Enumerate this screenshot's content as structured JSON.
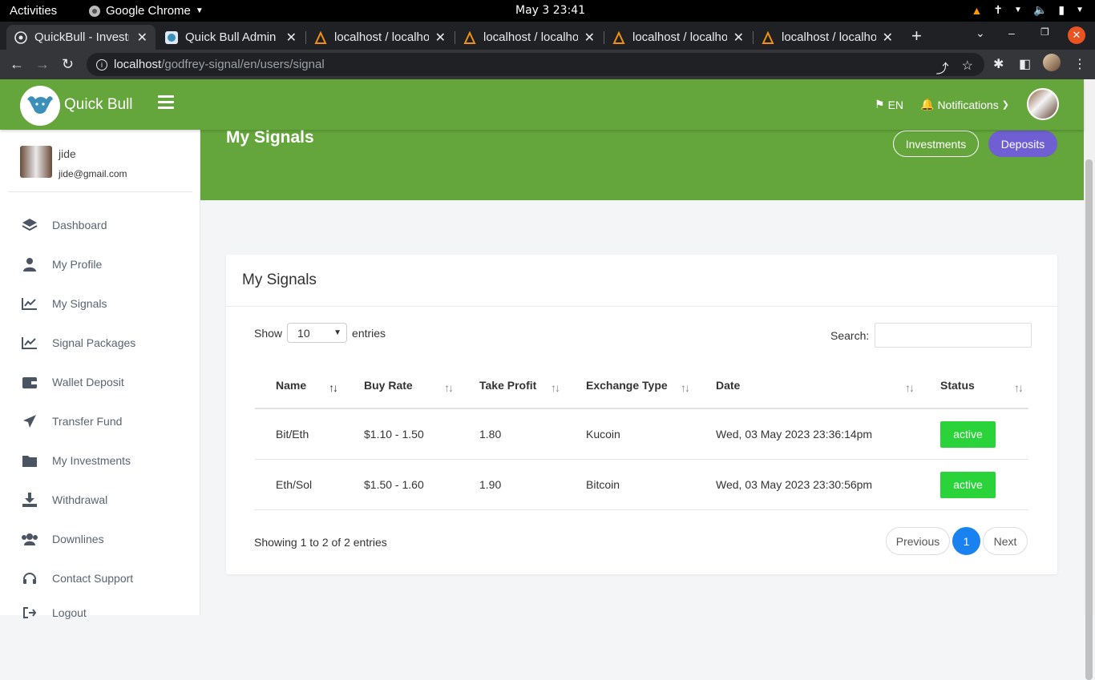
{
  "os": {
    "activities": "Activities",
    "app_name": "Google Chrome",
    "clock": "May 3  23:41"
  },
  "tabs": [
    {
      "title": "QuickBull - Investm"
    },
    {
      "title": "Quick Bull Admin"
    },
    {
      "title": "localhost / localho"
    },
    {
      "title": "localhost / localho"
    },
    {
      "title": "localhost / localho"
    },
    {
      "title": "localhost / localho"
    }
  ],
  "address": {
    "host": "localhost",
    "path": "/godfrey-signal/en/users/signal"
  },
  "header": {
    "brand": "Quick Bull",
    "lang": "EN",
    "notifications": "Notifications"
  },
  "user": {
    "name": "jide",
    "email": "jide@gmail.com"
  },
  "sidebar": {
    "items": [
      {
        "label": "Dashboard",
        "icon": "layers-icon"
      },
      {
        "label": "My Profile",
        "icon": "user-icon"
      },
      {
        "label": "My Signals",
        "icon": "chart-line-icon"
      },
      {
        "label": "Signal Packages",
        "icon": "chart-line-icon"
      },
      {
        "label": "Wallet Deposit",
        "icon": "wallet-icon"
      },
      {
        "label": "Transfer Fund",
        "icon": "paper-plane-icon"
      },
      {
        "label": "My Investments",
        "icon": "folder-icon"
      },
      {
        "label": "Withdrawal",
        "icon": "download-icon"
      },
      {
        "label": "Downlines",
        "icon": "users-icon"
      },
      {
        "label": "Contact Support",
        "icon": "headset-icon"
      },
      {
        "label": "Logout",
        "icon": "logout-icon"
      }
    ]
  },
  "banner": {
    "title": "My Signals",
    "investments_label": "Investments",
    "deposits_label": "Deposits"
  },
  "card": {
    "title": "My Signals",
    "show_label": "Show",
    "entries_value": "10",
    "entries_label": "entries",
    "search_label": "Search:",
    "search_value": "",
    "columns": [
      "Name",
      "Buy Rate",
      "Take Profit",
      "Exchange Type",
      "Date",
      "Status"
    ],
    "rows": [
      {
        "name": "Bit/Eth",
        "buy_rate": "$1.10 - 1.50",
        "take_profit": "1.80",
        "exchange": "Kucoin",
        "date": "Wed, 03 May 2023 23:36:14pm",
        "status": "active"
      },
      {
        "name": "Eth/Sol",
        "buy_rate": "$1.50 - 1.60",
        "take_profit": "1.90",
        "exchange": "Bitcoin",
        "date": "Wed, 03 May 2023 23:30:56pm",
        "status": "active"
      }
    ],
    "info": "Showing 1 to 2 of 2 entries",
    "previous": "Previous",
    "current_page": "1",
    "next": "Next"
  },
  "colors": {
    "brand_green": "#64a53c",
    "deposits_purple": "#6f5fd3",
    "active_badge": "#2bd33a",
    "page_blue": "#1a82f0"
  }
}
